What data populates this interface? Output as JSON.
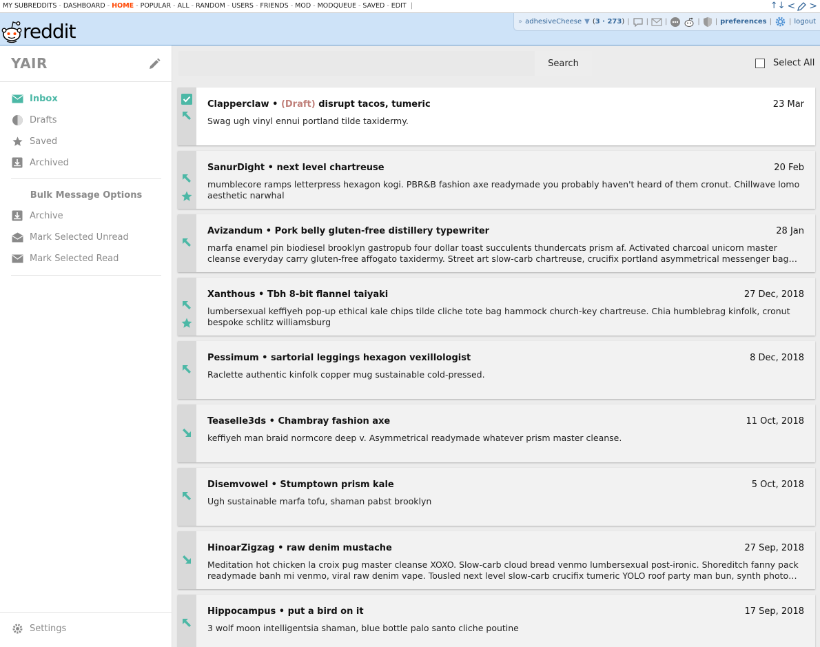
{
  "topbar": {
    "links": [
      "MY SUBREDDITS",
      "DASHBOARD",
      "HOME",
      "POPULAR",
      "ALL",
      "RANDOM",
      "USERS",
      "FRIENDS",
      "MOD",
      "MODQUEUE",
      "SAVED",
      "EDIT"
    ],
    "active": "HOME",
    "trailing": "|"
  },
  "header": {
    "logo_text": "reddit",
    "username": "adhesiveCheese",
    "karma_open": "(",
    "karma_link": "3",
    "karma_sep": " · ",
    "karma_comment": "273",
    "karma_close": ")",
    "preferences": "preferences",
    "logout": "logout",
    "expand_glyph": "»",
    "sep": "|"
  },
  "sidebar": {
    "title": "YAIR",
    "nav": [
      {
        "label": "Inbox",
        "icon": "mail-icon",
        "active": true
      },
      {
        "label": "Drafts",
        "icon": "draft-icon",
        "active": false
      },
      {
        "label": "Saved",
        "icon": "star-icon",
        "active": false
      },
      {
        "label": "Archived",
        "icon": "archive-icon",
        "active": false
      }
    ],
    "bulk_title": "Bulk Message Options",
    "bulk": [
      {
        "label": "Archive",
        "icon": "archive-icon"
      },
      {
        "label": "Mark Selected Unread",
        "icon": "open-mail-icon"
      },
      {
        "label": "Mark Selected Read",
        "icon": "mail-icon"
      }
    ],
    "settings": "Settings"
  },
  "search": {
    "placeholder": "",
    "button": "Search"
  },
  "select_all": "Select All",
  "colors": {
    "accent": "#4cb8a6",
    "draft": "#c0807a",
    "header_bg": "#cee3f8",
    "topbar_active": "#ff4500"
  },
  "messages": [
    {
      "author": "Clapperclaw",
      "draft": "(Draft)",
      "subject": "disrupt tacos, tumeric",
      "date": "23 Mar",
      "body": "Swag ugh vinyl ennui portland tilde taxidermy.",
      "direction": "sent-icon",
      "selected": true,
      "starred": false
    },
    {
      "author": "SanurDight",
      "draft": "",
      "subject": "next level chartreuse",
      "date": "20 Feb",
      "body": "mumblecore ramps letterpress hexagon kogi. PBR&B fashion axe readymade you probably haven't heard of them cronut. Chillwave lomo aesthetic narwhal",
      "direction": "sent-icon",
      "selected": false,
      "starred": true
    },
    {
      "author": "Avizandum",
      "draft": "",
      "subject": "Pork belly gluten-free distillery typewriter",
      "date": "28 Jan",
      "body": "marfa enamel pin biodiesel brooklyn gastropub four dollar toast succulents thundercats prism af. Activated charcoal unicorn master cleanse everyday carry gluten-free affogato taxidermy. Street art slow-carb chartreuse, crucifix portland asymmetrical messenger bag brooklyn kale chips",
      "direction": "sent-icon",
      "selected": false,
      "starred": false
    },
    {
      "author": "Xanthous",
      "draft": "",
      "subject": "Tbh 8-bit flannel taiyaki",
      "date": "27 Dec, 2018",
      "body": "lumbersexual keffiyeh pop-up ethical kale chips tilde cliche tote bag hammock church-key chartreuse. Chia humblebrag kinfolk, cronut bespoke schlitz williamsburg",
      "direction": "sent-icon",
      "selected": false,
      "starred": true
    },
    {
      "author": "Pessimum",
      "draft": "",
      "subject": "sartorial leggings hexagon vexillologist",
      "date": "8 Dec, 2018",
      "body": "Raclette authentic kinfolk copper mug sustainable cold-pressed.",
      "direction": "sent-icon",
      "selected": false,
      "starred": false
    },
    {
      "author": "Teaselle3ds",
      "draft": "",
      "subject": "Chambray fashion axe",
      "date": "11 Oct, 2018",
      "body": "keffiyeh man braid normcore deep v. Asymmetrical readymade whatever prism master cleanse.",
      "direction": "received-icon",
      "selected": false,
      "starred": false
    },
    {
      "author": "Disemvowel",
      "draft": "",
      "subject": "Stumptown prism kale",
      "date": "5 Oct, 2018",
      "body": "Ugh sustainable marfa tofu, shaman pabst brooklyn",
      "direction": "sent-icon",
      "selected": false,
      "starred": false
    },
    {
      "author": "HinoarZigzag",
      "draft": "",
      "subject": "raw denim mustache",
      "date": "27 Sep, 2018",
      "body": "Meditation hot chicken la croix pug master cleanse XOXO. Slow-carb cloud bread venmo lumbersexual post-ironic. Shoreditch fanny pack readymade banh mi venmo, viral raw denim vape. Tousled next level slow-carb crucifix tumeric YOLO roof party man bun, synth photo booth etsy",
      "direction": "received-icon",
      "selected": false,
      "starred": false
    },
    {
      "author": "Hippocampus",
      "draft": "",
      "subject": "put a bird on it",
      "date": "17 Sep, 2018",
      "body": "3 wolf moon intelligentsia shaman, blue bottle palo santo cliche poutine",
      "direction": "sent-icon",
      "selected": false,
      "starred": false
    }
  ]
}
